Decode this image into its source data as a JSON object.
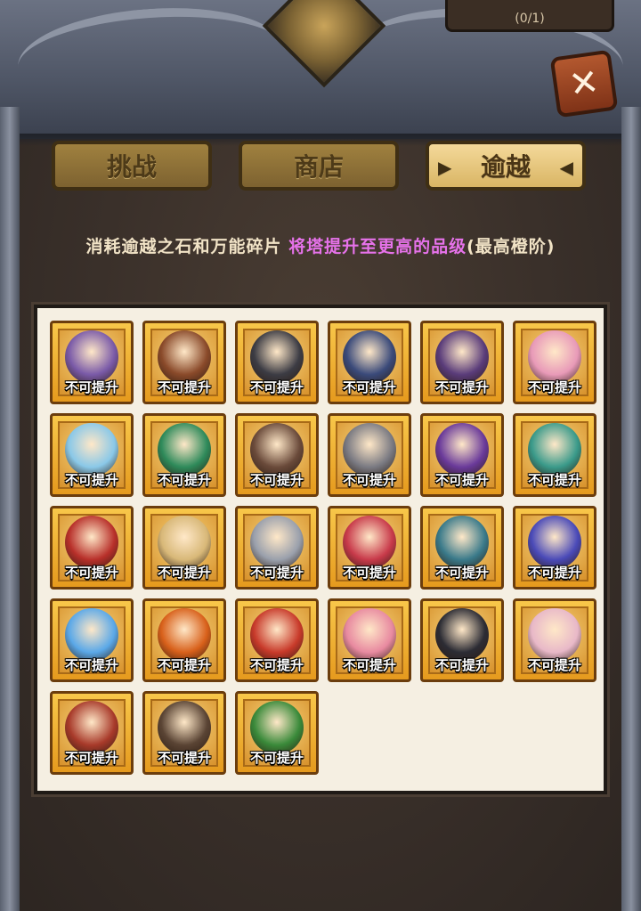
{
  "header": {
    "quest_counter": "(0/1)",
    "close_symbol": "✕"
  },
  "tabs": [
    {
      "label": "挑战",
      "active": false
    },
    {
      "label": "商店",
      "active": false
    },
    {
      "label": "逾越",
      "active": true
    }
  ],
  "description": {
    "part1": "消耗逾越之石和万能碎片 ",
    "part2": "将塔提升至更高的品级",
    "part3": "(最高橙阶)"
  },
  "colors": {
    "highlight": "#e672ea",
    "card_gold": "#f8c74a",
    "panel": "#f5efe2"
  },
  "heroes": [
    {
      "icon": "priestess-hero-icon",
      "status": "不可提升",
      "color": "#7a5aa8"
    },
    {
      "icon": "queen-hero-icon",
      "status": "不可提升",
      "color": "#8a4a2a"
    },
    {
      "icon": "samurai-hero-icon",
      "status": "不可提升",
      "color": "#3c3c44"
    },
    {
      "icon": "griffin-hero-icon",
      "status": "不可提升",
      "color": "#3a4a7a"
    },
    {
      "icon": "witch-hero-icon",
      "status": "不可提升",
      "color": "#5a3c7a"
    },
    {
      "icon": "flower-fairy-hero-icon",
      "status": "不可提升",
      "color": "#e89ab8"
    },
    {
      "icon": "ice-princess-hero-icon",
      "status": "不可提升",
      "color": "#8ac8e8"
    },
    {
      "icon": "medusa-hero-icon",
      "status": "不可提升",
      "color": "#2e8a5a"
    },
    {
      "icon": "elf-archer-hero-icon",
      "status": "不可提升",
      "color": "#6a4a3a"
    },
    {
      "icon": "viking-hero-icon",
      "status": "不可提升",
      "color": "#7a7a82"
    },
    {
      "icon": "dark-wizard-hero-icon",
      "status": "不可提升",
      "color": "#6a3a9a"
    },
    {
      "icon": "tribal-chief-hero-icon",
      "status": "不可提升",
      "color": "#3a9a8a"
    },
    {
      "icon": "spartan-hero-icon",
      "status": "不可提升",
      "color": "#b8302a"
    },
    {
      "icon": "valkyrie-hero-icon",
      "status": "不可提升",
      "color": "#d8b878"
    },
    {
      "icon": "knight-hero-icon",
      "status": "不可提升",
      "color": "#9aa0ac"
    },
    {
      "icon": "fire-mage-hero-icon",
      "status": "不可提升",
      "color": "#c83a4a"
    },
    {
      "icon": "sorcerer-hero-icon",
      "status": "不可提升",
      "color": "#3a7a8a"
    },
    {
      "icon": "orb-spirit-hero-icon",
      "status": "不可提升",
      "color": "#4a4ab8"
    },
    {
      "icon": "ice-golem-hero-icon",
      "status": "不可提升",
      "color": "#5aa8e8"
    },
    {
      "icon": "flame-demon-hero-icon",
      "status": "不可提升",
      "color": "#d8601a"
    },
    {
      "icon": "barbarian-hero-icon",
      "status": "不可提升",
      "color": "#c83a2a"
    },
    {
      "icon": "pirate-hero-icon",
      "status": "不可提升",
      "color": "#e88aa0"
    },
    {
      "icon": "ninja-hero-icon",
      "status": "不可提升",
      "color": "#2c2c34"
    },
    {
      "icon": "cat-girl-hero-icon",
      "status": "不可提升",
      "color": "#e8b8c8"
    },
    {
      "icon": "dwarf-hero-icon",
      "status": "不可提升",
      "color": "#a83a2a"
    },
    {
      "icon": "gorilla-hero-icon",
      "status": "不可提升",
      "color": "#5a4434"
    },
    {
      "icon": "ranger-hero-icon",
      "status": "不可提升",
      "color": "#3a8a3a"
    }
  ]
}
